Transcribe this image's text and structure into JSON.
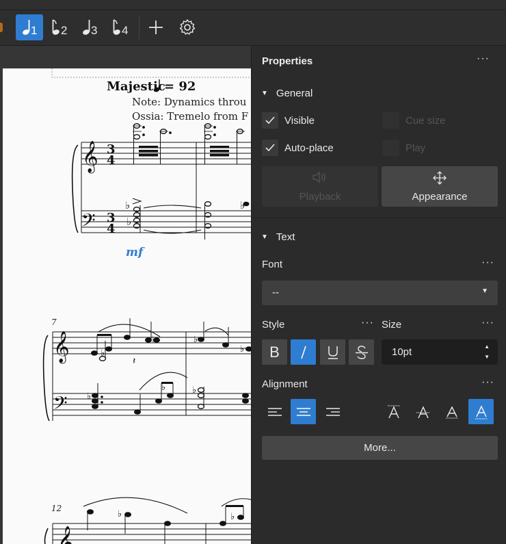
{
  "toolbar": {
    "voices": [
      {
        "label": "1",
        "active": true
      },
      {
        "label": "2",
        "active": false
      },
      {
        "label": "3",
        "active": false
      },
      {
        "label": "4",
        "active": false
      }
    ],
    "icons": [
      "add-icon",
      "gear-icon"
    ]
  },
  "score": {
    "title_text": "Majestic",
    "tempo": "= 92",
    "note_line1": "Note: Dynamics throu",
    "note_line2": "Ossia: Tremelo from F",
    "dynamic": "mf",
    "measure7": "7",
    "measure12": "12",
    "time_sig_top": "3",
    "time_sig_bottom": "4"
  },
  "properties": {
    "title": "Properties",
    "general": {
      "heading": "General",
      "visible_label": "Visible",
      "visible_checked": true,
      "autoplace_label": "Auto-place",
      "autoplace_checked": true,
      "cue_size_label": "Cue size",
      "play_label": "Play",
      "playback_label": "Playback",
      "appearance_label": "Appearance"
    },
    "text": {
      "heading": "Text",
      "font_label": "Font",
      "font_value": "--",
      "style_label": "Style",
      "size_label": "Size",
      "size_value": "10pt",
      "alignment_label": "Alignment",
      "style_buttons": [
        {
          "glyph": "B",
          "active": false
        },
        {
          "glyph": "I",
          "active": true
        },
        {
          "glyph": "U",
          "active": false
        },
        {
          "glyph": "S",
          "active": false
        }
      ],
      "more_label": "More..."
    },
    "accent_color": "#2f7dd1"
  }
}
